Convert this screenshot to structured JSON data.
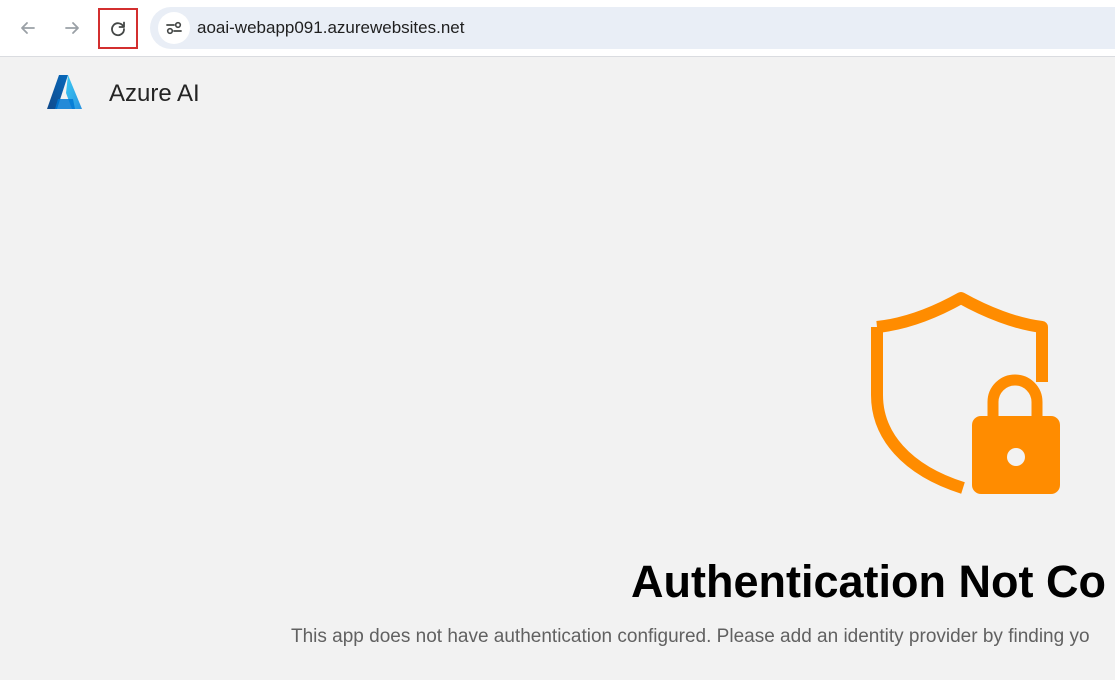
{
  "browser": {
    "url": "aoai-webapp091.azurewebsites.net",
    "reload_highlight_color": "#d32f2f",
    "icons": [
      "back-arrow-icon",
      "forward-arrow-icon",
      "reload-icon",
      "site-info-icon"
    ]
  },
  "header": {
    "brand": "Azure AI",
    "logo_icon": "azure-logo-icon"
  },
  "main": {
    "icon": "shield-lock-icon",
    "icon_color": "#ff8c00",
    "title": "Authentication Not Co",
    "description": "This app does not have authentication configured. Please add an identity provider by finding yo"
  }
}
